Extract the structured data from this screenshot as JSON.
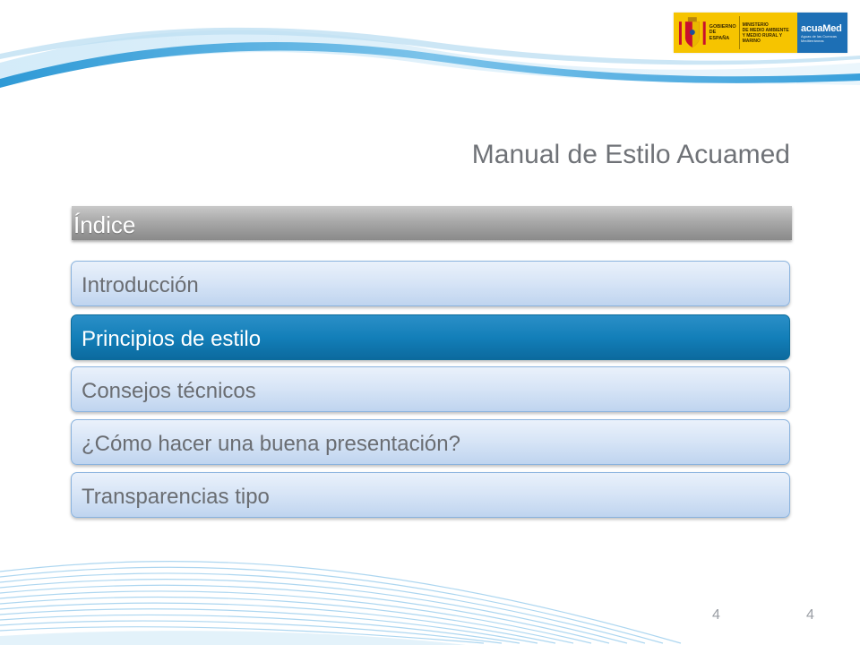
{
  "logos": {
    "gobierno_lines": [
      "GOBIERNO",
      "DE ESPAÑA"
    ],
    "ministerio_lines": [
      "MINISTERIO",
      "DE MEDIO AMBIENTE",
      "Y MEDIO RURAL Y MARINO"
    ],
    "acuamed_name": "acuaMed",
    "acuamed_tagline": "Aguas de las Cuencas Mediterráneas"
  },
  "title": "Manual de Estilo Acuamed",
  "index": {
    "label": "Índice"
  },
  "menu": {
    "items": [
      {
        "label": "Introducción",
        "active": false
      },
      {
        "label": "Principios de estilo",
        "active": true
      },
      {
        "label": "Consejos técnicos",
        "active": false
      },
      {
        "label": "¿Cómo hacer una buena presentación?",
        "active": false
      },
      {
        "label": "Transparencias tipo",
        "active": false
      }
    ]
  },
  "page_numbers": [
    "4",
    "4"
  ],
  "colors": {
    "accent": "#137fb9",
    "item_fill": "#d6e4f6",
    "index_bar": "#a9a9a9",
    "title_text": "#6f7277",
    "gobierno_yellow": "#f6c400",
    "acuamed_blue": "#1d6fb5"
  }
}
